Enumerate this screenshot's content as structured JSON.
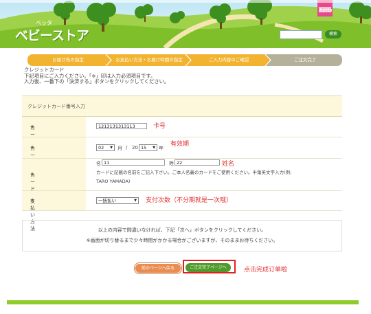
{
  "header": {
    "logo_small": "ベッタ",
    "logo": "ベビーストア",
    "badge": "betta",
    "search_button": "検索",
    "search_value": ""
  },
  "steps": [
    "お届け先の指定",
    "お支払い方法・お届け時間の指定",
    "ご入力内容のご確認",
    "ご注文完了"
  ],
  "intro": [
    "クレジットカード",
    "下記項目にご入力ください。「※」印は入力必須項目です。",
    "入力後、一番下の「決済する」ボタンをクリックしてください。"
  ],
  "form": {
    "section_title": "クレジットカード番号入力",
    "required_mark": "※",
    "card_number": {
      "label": "カード番号",
      "value": "1213131313113",
      "annotation": "卡号"
    },
    "expiry": {
      "label": "カード有効期限",
      "month": "02",
      "month_unit": "月",
      "separator": "/",
      "year_prefix": "20",
      "year": "15",
      "year_unit": "年",
      "annotation": "有效期"
    },
    "card_name": {
      "label": "カード名義",
      "first_label": "名",
      "first_value": "11",
      "last_label": "姓",
      "last_value": "22",
      "annotation": "姓名",
      "hint": "カードに記載の名前をご記入下さい。ご本人名義のカードをご使用ください。半角英文字入力(例:",
      "example": "TARO YAMADA)"
    },
    "payment": {
      "label": "支払い方法",
      "value": "一括払い",
      "annotation": "支付次数（不分期就是一次哦）"
    }
  },
  "note": [
    "以上の内容で間違いなければ、下記「次へ」ボタンをクリックしてください。",
    "※画面が切り替るまで少々時間がかかる場合がございますが、そのままお待ちください。"
  ],
  "buttons": {
    "back": "前のページへ戻る",
    "next": "ご注文完了ページへ",
    "annotation": "点击完成订单啦"
  },
  "colors": {
    "step_active": "#f2b331",
    "step_current": "#b5b09a",
    "accent_green": "#3a8d24",
    "annotation_red": "#e23030"
  }
}
